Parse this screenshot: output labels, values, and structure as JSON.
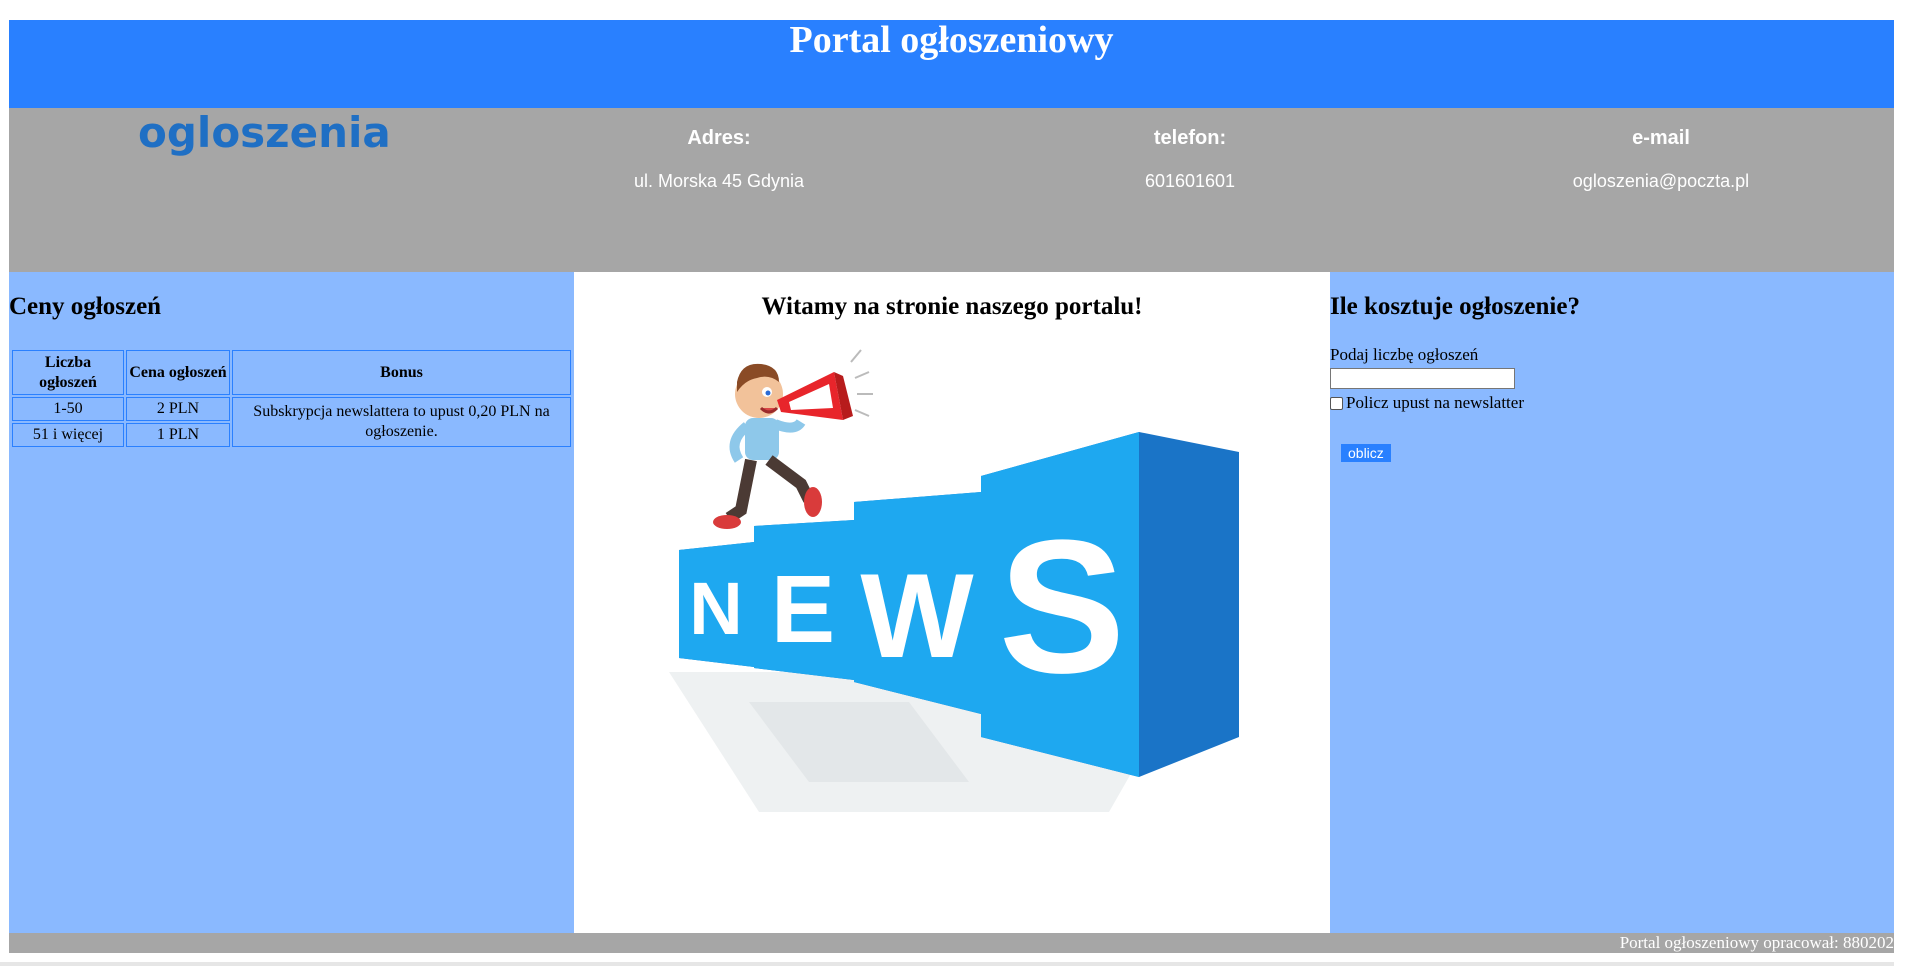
{
  "header": {
    "title": "Portal ogłoszeniowy"
  },
  "info": {
    "logo_text": "ogloszenia",
    "address_label": "Adres:",
    "address_value": "ul. Morska 45 Gdynia",
    "phone_label": "telefon:",
    "phone_value": "601601601",
    "email_label": "e-mail",
    "email_value": "ogloszenia@poczta.pl"
  },
  "left": {
    "heading": "Ceny ogłoszeń",
    "table": {
      "headers": [
        "Liczba ogłoszeń",
        "Cena ogłoszeń",
        "Bonus"
      ],
      "rows": [
        [
          "1-50",
          "2 PLN"
        ],
        [
          "51 i więcej",
          "1 PLN"
        ]
      ],
      "bonus": "Subskrypcja newslattera to upust 0,20 PLN na ogłoszenie."
    }
  },
  "center": {
    "heading": "Witamy na stronie naszego portalu!",
    "image_letters": [
      "N",
      "E",
      "W",
      "S"
    ]
  },
  "right": {
    "heading": "Ile kosztuje ogłoszenie?",
    "input_label": "Podaj liczbę ogłoszeń",
    "input_value": "",
    "checkbox_label": "Policz upust na newslatter",
    "checkbox_checked": false,
    "button_label": "oblicz"
  },
  "footer": {
    "text": "Portal ogłoszeniowy opracował: 880202"
  },
  "colors": {
    "banner": "#2980ff",
    "info_bar": "#a6a6a6",
    "side_columns": "#8ab9ff",
    "cube_front": "#1ea8f0",
    "cube_side": "#1a74c7"
  }
}
